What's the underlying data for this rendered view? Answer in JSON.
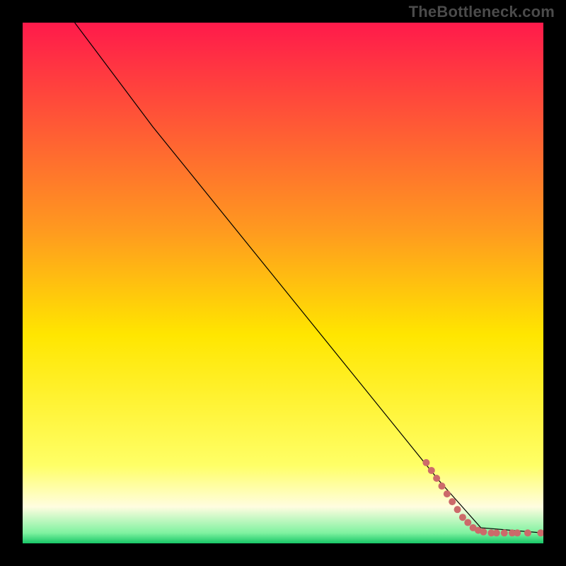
{
  "watermark": "TheBottleneck.com",
  "chart_data": {
    "type": "line",
    "title": "",
    "xlabel": "",
    "ylabel": "",
    "xlim": [
      0,
      100
    ],
    "ylim": [
      0,
      100
    ],
    "grid": false,
    "legend": false,
    "background": {
      "gradient_stops": [
        {
          "y": 100,
          "color": "#ff1a4b"
        },
        {
          "y": 60,
          "color": "#ff9a1f"
        },
        {
          "y": 40,
          "color": "#ffe600"
        },
        {
          "y": 15,
          "color": "#ffff66"
        },
        {
          "y": 7,
          "color": "#fffde0"
        },
        {
          "y": 2,
          "color": "#7ff2a0"
        },
        {
          "y": 0,
          "color": "#17c667"
        }
      ]
    },
    "series": [
      {
        "name": "bottleneck-curve",
        "color": "#000000",
        "stroke_width": 1.2,
        "x": [
          10,
          25,
          80,
          88,
          100
        ],
        "y": [
          100,
          80,
          12,
          3,
          2
        ]
      }
    ],
    "points": {
      "name": "data-points",
      "color": "#cc6a6a",
      "radius": 5,
      "data": [
        {
          "x": 77.5,
          "y": 15.5
        },
        {
          "x": 78.5,
          "y": 14.0
        },
        {
          "x": 79.5,
          "y": 12.5
        },
        {
          "x": 80.5,
          "y": 11.0
        },
        {
          "x": 81.5,
          "y": 9.5
        },
        {
          "x": 82.5,
          "y": 8.0
        },
        {
          "x": 83.5,
          "y": 6.5
        },
        {
          "x": 84.5,
          "y": 5.0
        },
        {
          "x": 85.5,
          "y": 4.0
        },
        {
          "x": 86.5,
          "y": 3.0
        },
        {
          "x": 87.5,
          "y": 2.5
        },
        {
          "x": 88.5,
          "y": 2.2
        },
        {
          "x": 90.0,
          "y": 2.0
        },
        {
          "x": 91.0,
          "y": 2.0
        },
        {
          "x": 92.5,
          "y": 2.0
        },
        {
          "x": 94.0,
          "y": 2.0
        },
        {
          "x": 95.0,
          "y": 2.0
        },
        {
          "x": 97.0,
          "y": 2.0
        },
        {
          "x": 99.5,
          "y": 2.0
        }
      ]
    }
  }
}
